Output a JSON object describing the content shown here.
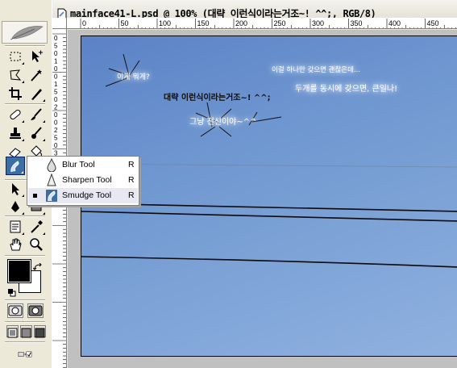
{
  "document": {
    "title": "mainface41-L.psd @ 100% (대략 이런식이라는거조~! ^^;, RGB/8)",
    "hruler_labels": [
      "0",
      "50",
      "100",
      "150",
      "200",
      "250",
      "300",
      "350",
      "400",
      "450"
    ],
    "vruler_labels": [
      "0",
      "5",
      "0",
      "1",
      "0",
      "0",
      "1",
      "5",
      "0",
      "2",
      "0",
      "0",
      "2",
      "5",
      "0",
      "3",
      "0",
      "0",
      "3",
      "5",
      "0"
    ]
  },
  "canvas_text": {
    "t1": "이게 뭐게?",
    "t2": "대략 이런식이라는거조~! ^^;",
    "t3": "그냥 전선이야~^^",
    "t4": "이걸 하나만 갖으면 괜찮은데...",
    "t5": "두개를 동시에 갖으면, 큰일나!"
  },
  "flyout": {
    "items": [
      {
        "label": "Blur Tool",
        "shortcut": "R",
        "icon": "blur-drop-icon"
      },
      {
        "label": "Sharpen Tool",
        "shortcut": "R",
        "icon": "sharpen-cone-icon"
      },
      {
        "label": "Smudge Tool",
        "shortcut": "R",
        "icon": "smudge-finger-icon",
        "selected": true
      }
    ]
  },
  "colors": {
    "foreground": "#000000",
    "background": "#ffffff",
    "selection": "#3a6ea5",
    "sky_top": "#5b82c6",
    "sky_bottom": "#8fb1df"
  }
}
